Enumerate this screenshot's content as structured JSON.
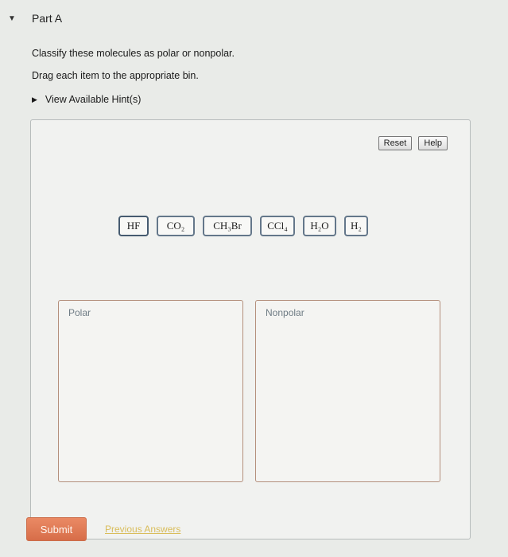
{
  "part": {
    "toggle_icon": "▼",
    "title": "Part A"
  },
  "instructions": [
    "Classify these molecules as polar or nonpolar.",
    "Drag each item to the appropriate bin."
  ],
  "hint": {
    "arrow_icon": "▶",
    "label": "View Available Hint(s)"
  },
  "toolbar": {
    "reset_label": "Reset",
    "help_label": "Help"
  },
  "molecules": [
    "HF",
    "CO₂",
    "CH₃Br",
    "CCl₄",
    "H₂O",
    "H₂"
  ],
  "bins": {
    "polar_label": "Polar",
    "nonpolar_label": "Nonpolar"
  },
  "footer": {
    "submit_label": "Submit",
    "previous_answers_label": "Previous Answers"
  }
}
